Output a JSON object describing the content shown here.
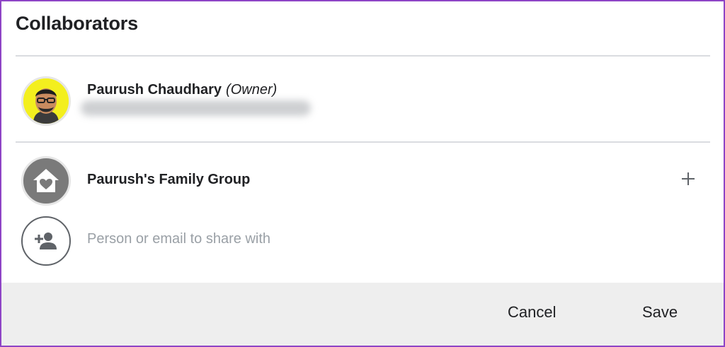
{
  "dialog": {
    "title": "Collaborators"
  },
  "owner": {
    "name": "Paurush Chaudhary",
    "role": "(Owner)",
    "avatar_icon": "user-photo-avatar"
  },
  "group": {
    "name": "Paurush's Family Group",
    "avatar_icon": "family-home-heart-icon",
    "add_icon": "plus-icon"
  },
  "share": {
    "placeholder": "Person or email to share with",
    "value": "",
    "icon": "person-add-icon"
  },
  "actions": {
    "cancel_label": "Cancel",
    "save_label": "Save"
  },
  "colors": {
    "frame_border": "#8e44c6",
    "footer_bg": "#eeeeee",
    "divider": "#dadce0",
    "owner_avatar_bg": "#f3ef1e"
  }
}
